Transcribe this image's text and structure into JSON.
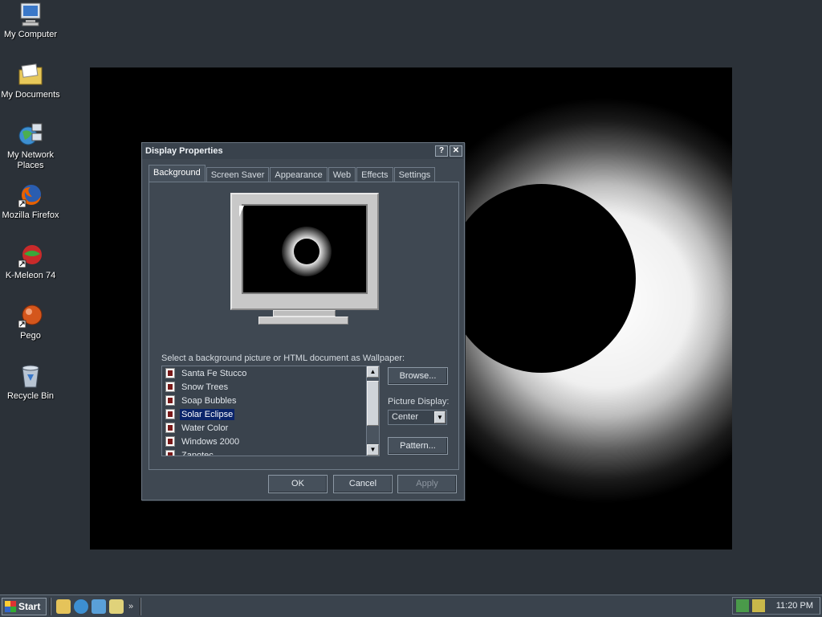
{
  "desktop": {
    "icons": [
      {
        "label": "My Computer"
      },
      {
        "label": "My Documents"
      },
      {
        "label": "My Network Places"
      },
      {
        "label": "Mozilla Firefox"
      },
      {
        "label": "K-Meleon 74"
      },
      {
        "label": "Pego"
      },
      {
        "label": "Recycle Bin"
      }
    ]
  },
  "dialog": {
    "title": "Display Properties",
    "help_btn": "?",
    "close_btn": "✕",
    "tabs": [
      "Background",
      "Screen Saver",
      "Appearance",
      "Web",
      "Effects",
      "Settings"
    ],
    "active_tab": "Background",
    "instruction": "Select a background picture or HTML document as Wallpaper:",
    "wallpapers": [
      "Santa Fe Stucco",
      "Snow Trees",
      "Soap Bubbles",
      "Solar Eclipse",
      "Water Color",
      "Windows 2000",
      "Zapotec"
    ],
    "selected_wallpaper": "Solar Eclipse",
    "browse_label": "Browse...",
    "picture_display_label": "Picture Display:",
    "picture_display_value": "Center",
    "pattern_label": "Pattern...",
    "ok_label": "OK",
    "cancel_label": "Cancel",
    "apply_label": "Apply"
  },
  "taskbar": {
    "start_label": "Start",
    "chevron": "»",
    "clock": "11:20 PM"
  }
}
